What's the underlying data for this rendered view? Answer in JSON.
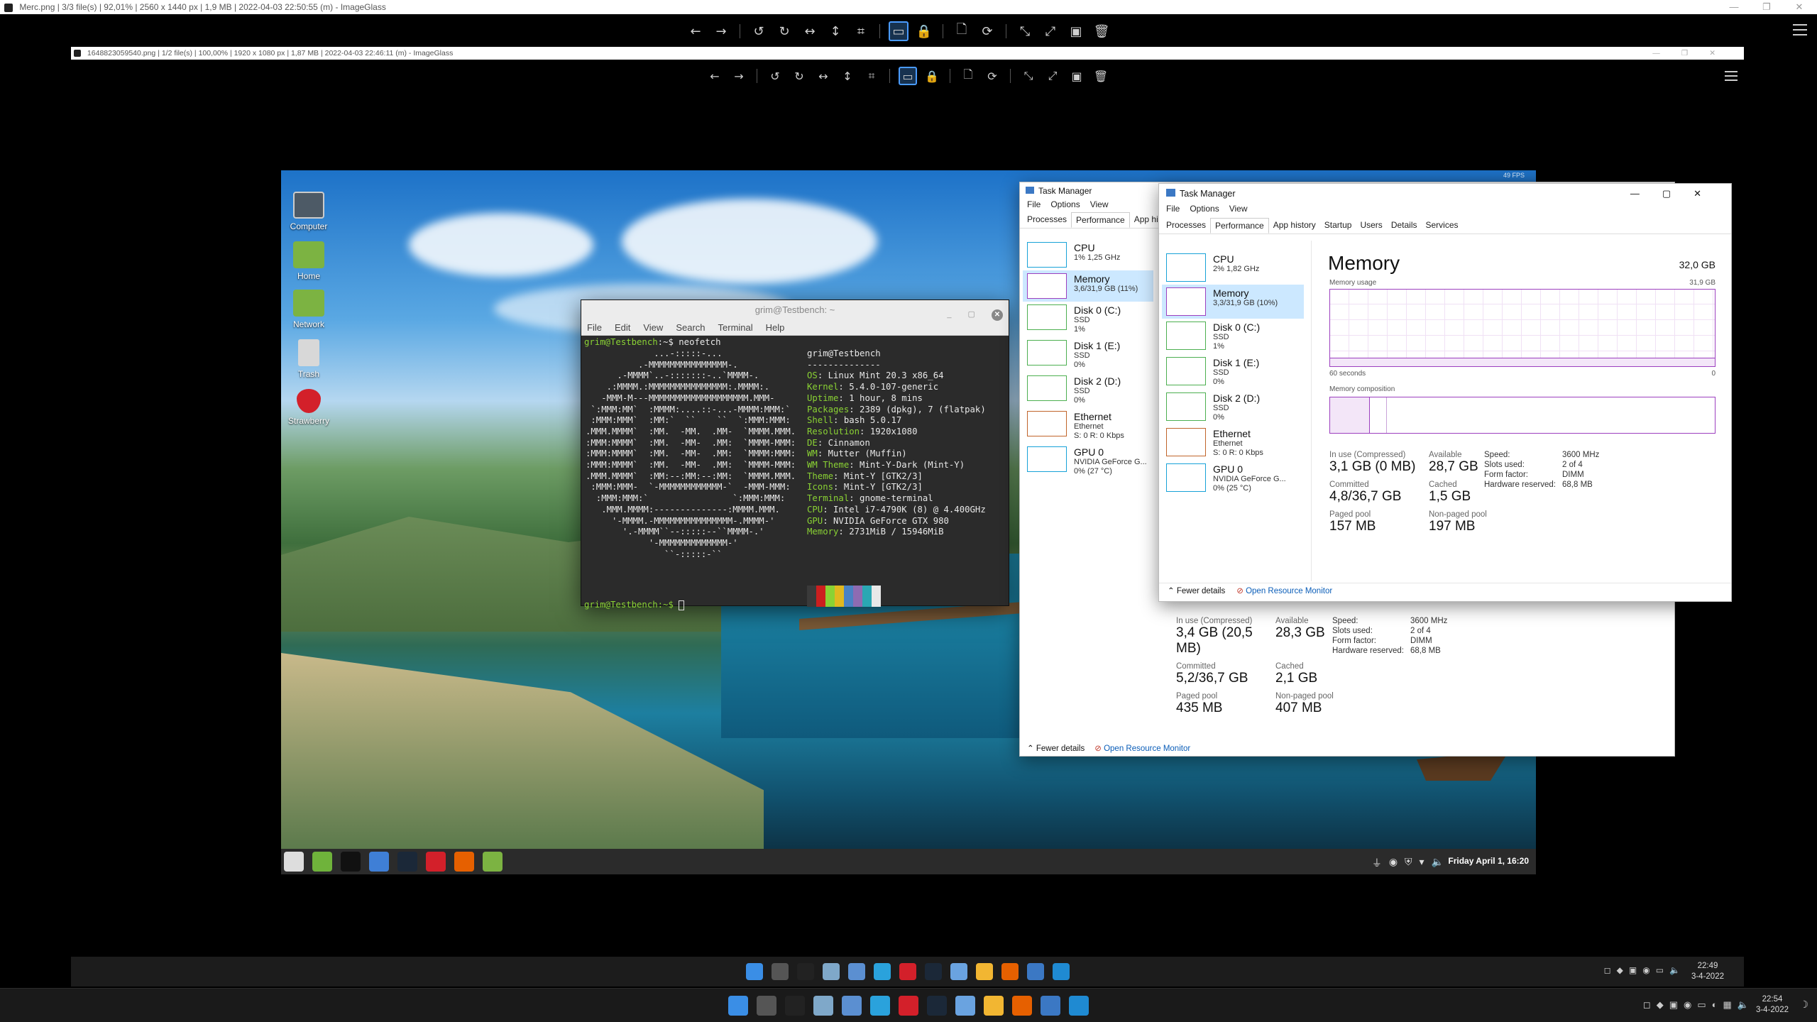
{
  "outer_window": {
    "title": "Merc.png | 3/3 file(s) | 92,01% | 2560 x 1440 px | 1,9 MB | 2022-04-03 22:50:55 (m) - ImageGlass"
  },
  "inner_window": {
    "title": "1648823059540.png | 1/2 file(s) | 100,00% | 1920 x 1080 px | 1,87 MB | 2022-04-03 22:46:11 (m) - ImageGlass"
  },
  "toolbar_icons": [
    "back-icon",
    "forward-icon",
    "rotate-left-icon",
    "rotate-right-icon",
    "flip-horizontal-icon",
    "flip-vertical-icon",
    "crop-icon",
    "fit-window-icon",
    "lock-icon",
    "open-file-icon",
    "refresh-icon",
    "zoom-fit-icon",
    "fullscreen-icon",
    "slideshow-icon",
    "delete-icon"
  ],
  "desktop": {
    "fps": "49 FPS",
    "icons": [
      "Computer",
      "Home",
      "Network",
      "Trash",
      "Strawberry"
    ]
  },
  "terminal": {
    "title": "grim@Testbench: ~",
    "menu": [
      "File",
      "Edit",
      "View",
      "Search",
      "Terminal",
      "Help"
    ],
    "prompt": "grim@Testbench",
    "command": "neofetch",
    "logo": [
      "             ...-:::::-...",
      "          .-MMMMMMMMMMMMMMM-.",
      "      .-MMMM`..-:::::::-..`MMMM-.",
      "    .:MMMM.:MMMMMMMMMMMMMMM:.MMMM:.",
      "   -MMM-M---MMMMMMMMMMMMMMMMMMM.MMM-",
      " `:MMM:MM`  :MMMM:....::-...-MMMM:MMM:`",
      " :MMM:MMM`  :MM:`  ``    ``  `:MMM:MMM:",
      ".MMM.MMMM`  :MM.  -MM.  .MM-  `MMMM.MMM.",
      ":MMM:MMMM`  :MM.  -MM-  .MM:  `MMMM-MMM:",
      ":MMM:MMMM`  :MM.  -MM-  .MM:  `MMMM:MMM:",
      ":MMM:MMMM`  :MM.  -MM-  .MM:  `MMMM-MMM:",
      ".MMM.MMMM`  :MM:--:MM:--:MM:  `MMMM.MMM.",
      " :MMM:MMM-  `-MMMMMMMMMMMM-`  -MMM-MMM:",
      "  :MMM:MMM:`                `:MMM:MMM:",
      "   .MMM.MMMM:--------------:MMMM.MMM.",
      "     '-MMMM.-MMMMMMMMMMMMMMM-.MMMM-'",
      "       '.-MMMM``--:::::--``MMMM-.'",
      "            '-MMMMMMMMMMMMM-'",
      "               ``-:::::-``"
    ],
    "info_title": "grim@Testbench",
    "info_sep": "--------------",
    "info": [
      [
        "OS",
        "Linux Mint 20.3 x86_64"
      ],
      [
        "Kernel",
        "5.4.0-107-generic"
      ],
      [
        "Uptime",
        "1 hour, 8 mins"
      ],
      [
        "Packages",
        "2389 (dpkg), 7 (flatpak)"
      ],
      [
        "Shell",
        "bash 5.0.17"
      ],
      [
        "Resolution",
        "1920x1080"
      ],
      [
        "DE",
        "Cinnamon"
      ],
      [
        "WM",
        "Mutter (Muffin)"
      ],
      [
        "WM Theme",
        "Mint-Y-Dark (Mint-Y)"
      ],
      [
        "Theme",
        "Mint-Y [GTK2/3]"
      ],
      [
        "Icons",
        "Mint-Y [GTK2/3]"
      ],
      [
        "Terminal",
        "gnome-terminal"
      ],
      [
        "CPU",
        "Intel i7-4790K (8) @ 4.400GHz"
      ],
      [
        "GPU",
        "NVIDIA GeForce GTX 980"
      ],
      [
        "Memory",
        "2731MiB / 15946MiB"
      ]
    ],
    "palette": [
      "#3a3a3a",
      "#cc1f1f",
      "#8ad234",
      "#e0b81f",
      "#4a82c4",
      "#8e6bb2",
      "#2aa7b3",
      "#e8e8e8"
    ],
    "final_prompt": "grim@Testbench:~$"
  },
  "linux_tray": {
    "clock": "Friday April 1, 16:20"
  },
  "tm_back": {
    "title": "Task Manager",
    "menu": [
      "File",
      "Options",
      "View"
    ],
    "tabs": [
      "Processes",
      "Performance",
      "App history"
    ],
    "items": [
      {
        "name": "CPU",
        "sub": [
          "1% 1,25 GHz"
        ]
      },
      {
        "name": "Memory",
        "sub": [
          "3,6/31,9 GB (11%)"
        ]
      },
      {
        "name": "Disk 0 (C:)",
        "sub": [
          "SSD",
          "1%"
        ]
      },
      {
        "name": "Disk 1 (E:)",
        "sub": [
          "SSD",
          "0%"
        ]
      },
      {
        "name": "Disk 2 (D:)",
        "sub": [
          "SSD",
          "0%"
        ]
      },
      {
        "name": "Ethernet",
        "sub": [
          "Ethernet",
          "S: 0 R: 0 Kbps"
        ]
      },
      {
        "name": "GPU 0",
        "sub": [
          "NVIDIA GeForce G...",
          "0% (27 °C)"
        ]
      }
    ],
    "stats": {
      "in_use_label": "In use (Compressed)",
      "in_use": "3,4 GB (20,5 MB)",
      "available_label": "Available",
      "available": "28,3 GB",
      "committed_label": "Committed",
      "committed": "5,2/36,7 GB",
      "cached_label": "Cached",
      "cached": "2,1 GB",
      "paged_label": "Paged pool",
      "paged": "435 MB",
      "nonpaged_label": "Non-paged pool",
      "nonpaged": "407 MB"
    },
    "kv": [
      [
        "Speed:",
        "3600 MHz"
      ],
      [
        "Slots used:",
        "2 of 4"
      ],
      [
        "Form factor:",
        "DIMM"
      ],
      [
        "Hardware reserved:",
        "68,8 MB"
      ]
    ],
    "fewer": "Fewer details",
    "resmon": "Open Resource Monitor"
  },
  "tm_front": {
    "title": "Task Manager",
    "menu": [
      "File",
      "Options",
      "View"
    ],
    "tabs": [
      "Processes",
      "Performance",
      "App history",
      "Startup",
      "Users",
      "Details",
      "Services"
    ],
    "items": [
      {
        "name": "CPU",
        "sub": [
          "2% 1,82 GHz"
        ]
      },
      {
        "name": "Memory",
        "sub": [
          "3,3/31,9 GB (10%)"
        ]
      },
      {
        "name": "Disk 0 (C:)",
        "sub": [
          "SSD",
          "1%"
        ]
      },
      {
        "name": "Disk 1 (E:)",
        "sub": [
          "SSD",
          "0%"
        ]
      },
      {
        "name": "Disk 2 (D:)",
        "sub": [
          "SSD",
          "0%"
        ]
      },
      {
        "name": "Ethernet",
        "sub": [
          "Ethernet",
          "S: 0 R: 0 Kbps"
        ]
      },
      {
        "name": "GPU 0",
        "sub": [
          "NVIDIA GeForce G...",
          "0% (25 °C)"
        ]
      }
    ],
    "heading": "Memory",
    "total": "32,0 GB",
    "usage_label": "Memory usage",
    "usage_max": "31,9 GB",
    "seconds": "60 seconds",
    "zero": "0",
    "composition": "Memory composition",
    "stats": {
      "in_use_label": "In use (Compressed)",
      "in_use": "3,1 GB (0 MB)",
      "available_label": "Available",
      "available": "28,7 GB",
      "committed_label": "Committed",
      "committed": "4,8/36,7 GB",
      "cached_label": "Cached",
      "cached": "1,5 GB",
      "paged_label": "Paged pool",
      "paged": "157 MB",
      "nonpaged_label": "Non-paged pool",
      "nonpaged": "197 MB"
    },
    "kv": [
      [
        "Speed:",
        "3600 MHz"
      ],
      [
        "Slots used:",
        "2 of 4"
      ],
      [
        "Form factor:",
        "DIMM"
      ],
      [
        "Hardware reserved:",
        "68,8 MB"
      ]
    ],
    "fewer": "Fewer details",
    "resmon": "Open Resource Monitor"
  },
  "inner_taskbar": {
    "time": "22:49",
    "date": "3-4-2022"
  },
  "outer_taskbar": {
    "time": "22:54",
    "date": "3-4-2022"
  }
}
